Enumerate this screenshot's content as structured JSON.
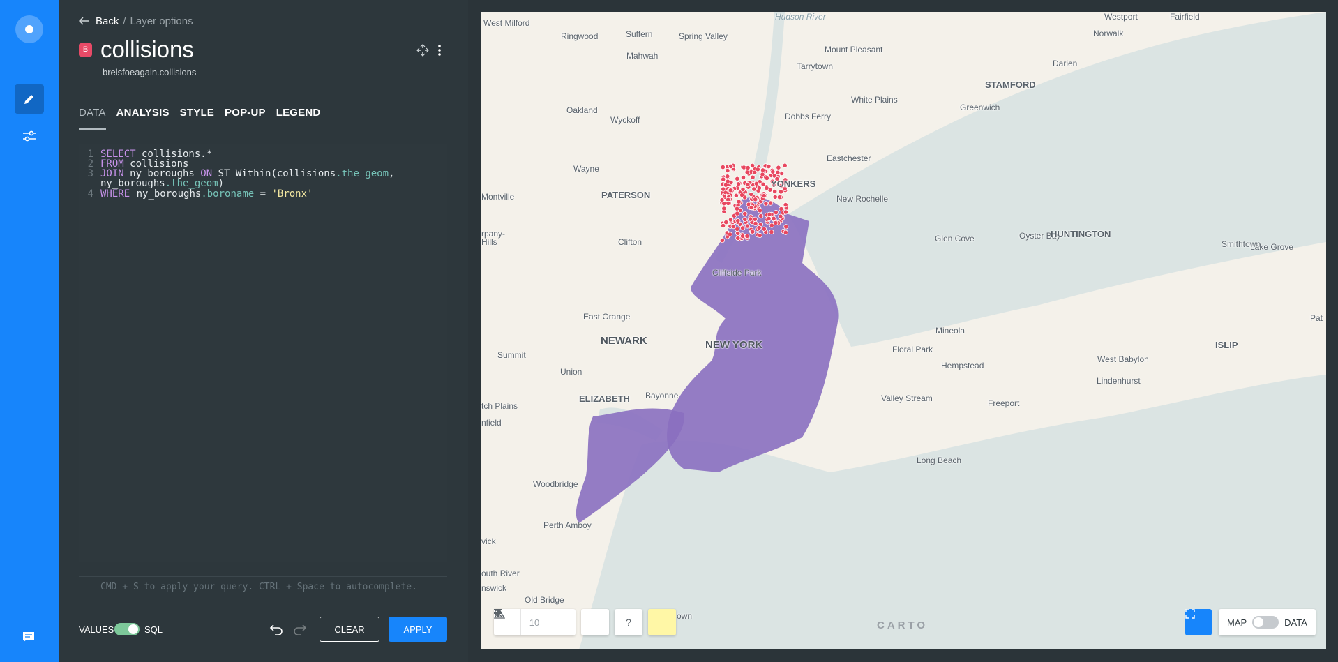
{
  "breadcrumb": {
    "back": "Back",
    "separator": "/",
    "current": "Layer options"
  },
  "layer": {
    "badge": "B",
    "name": "collisions",
    "source": "brelsfoeagain.collisions"
  },
  "tabs": [
    {
      "label": "DATA",
      "active": true
    },
    {
      "label": "ANALYSIS",
      "active": false
    },
    {
      "label": "STYLE",
      "active": false
    },
    {
      "label": "POP-UP",
      "active": false
    },
    {
      "label": "LEGEND",
      "active": false
    }
  ],
  "editor": {
    "line_numbers": [
      "1",
      "2",
      "3",
      "4"
    ],
    "lines": [
      {
        "tokens": [
          [
            "kw",
            "SELECT"
          ],
          [
            "plain",
            " collisions.*"
          ]
        ]
      },
      {
        "tokens": [
          [
            "kw",
            "FROM"
          ],
          [
            "plain",
            " collisions"
          ]
        ]
      },
      {
        "tokens": [
          [
            "kw",
            "JOIN"
          ],
          [
            "plain",
            " ny_boroughs "
          ],
          [
            "kw",
            "ON"
          ],
          [
            "plain",
            " ST_Within(collisions"
          ],
          [
            "field",
            ".the_geom"
          ],
          [
            "plain",
            ","
          ]
        ]
      },
      {
        "tokens": [
          [
            "plain",
            "ny_boroughs"
          ],
          [
            "field",
            ".the_geom"
          ],
          [
            "plain",
            ")"
          ]
        ]
      },
      {
        "tokens": [
          [
            "kw",
            "WHERE"
          ],
          [
            "plain",
            " ny_boroughs"
          ],
          [
            "field",
            ".boroname"
          ],
          [
            "plain",
            " = "
          ],
          [
            "str",
            "'Bronx'"
          ]
        ]
      }
    ],
    "hint": "CMD + S to apply your query. CTRL + Space to autocomplete."
  },
  "footer": {
    "values_label": "VALUES",
    "sql_label": "SQL",
    "sql_mode_on": true,
    "clear_label": "CLEAR",
    "apply_label": "APPLY"
  },
  "map": {
    "zoom_level": "10",
    "help_label": "?",
    "attribution": "CARTO",
    "switch_map_label": "MAP",
    "switch_data_label": "DATA",
    "colors": {
      "borough_fill": "#8a6fc0",
      "point_fill": "#e8475f",
      "water": "#dbe4e3",
      "land": "#f4f1ea",
      "accent": "#1785fb"
    },
    "places": {
      "west_milford": "West Milford",
      "ringwood": "Ringwood",
      "suffern": "Suffern",
      "spring_valley": "Spring Valley",
      "hudson_river": "Hudson River",
      "westport": "Westport",
      "fairfield": "Fairfield",
      "mahwah": "Mahwah",
      "mount_pleasant": "Mount Pleasant",
      "norwalk": "Norwalk",
      "tarrytown": "Tarrytown",
      "darien": "Darien",
      "oakland": "Oakland",
      "stamford": "STAMFORD",
      "white_plains": "White Plains",
      "greenwich": "Greenwich",
      "wyckoff": "Wyckoff",
      "dobbs_ferry": "Dobbs Ferry",
      "eastchester": "Eastchester",
      "wayne": "Wayne",
      "yonkers": "YONKERS",
      "paterson": "PATERSON",
      "montville": "Montville",
      "new_rochelle": "New Rochelle",
      "clifton": "Clifton",
      "glen_cove": "Glen Cove",
      "oyster_bay": "Oyster Bay",
      "huntington": "HUNTINGTON",
      "smithtown": "Smithtown",
      "lake_grove": "Lake Grove",
      "parsippany": "rpany-",
      "hills": "Hills",
      "cliffside_park": "Cliffside Park",
      "east_orange": "East Orange",
      "mineola": "Mineola",
      "pat": "Pat",
      "newark": "NEWARK",
      "new_york": "NEW YORK",
      "floral_park": "Floral Park",
      "islip": "ISLIP",
      "west_babylon": "West Babylon",
      "summit": "Summit",
      "hempstead": "Hempstead",
      "union": "Union",
      "lindenhurst": "Lindenhurst",
      "elizabeth": "ELIZABETH",
      "bayonne": "Bayonne",
      "valley_stream": "Valley Stream",
      "freeport": "Freeport",
      "scotch_plains": "tch Plains",
      "plainfield": "nfield",
      "long_beach": "Long Beach",
      "woodbridge": "Woodbridge",
      "perth_amboy": "Perth Amboy",
      "edison": "vick",
      "south_river": "outh River",
      "brunswick": "nswick",
      "old_bridge": "Old Bridge",
      "town": "own"
    }
  }
}
